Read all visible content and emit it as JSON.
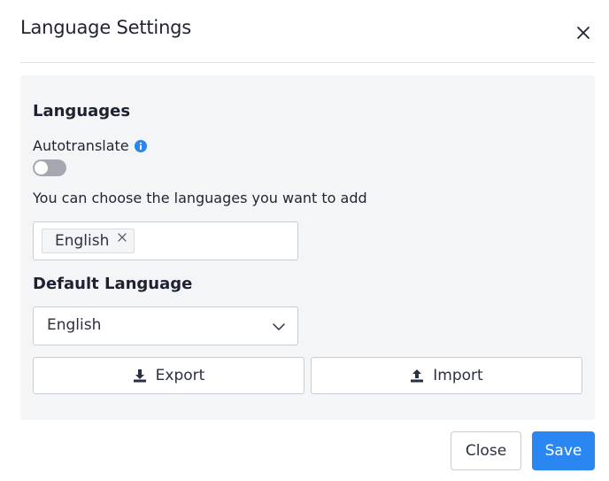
{
  "dialog": {
    "title": "Language Settings",
    "close_icon": "close-icon"
  },
  "languages": {
    "heading": "Languages",
    "autotranslate_label": "Autotranslate",
    "autotranslate_enabled": false,
    "info_icon": "info-icon",
    "helper_text": "You can choose the languages you want to add",
    "selected": [
      "English"
    ]
  },
  "default_language": {
    "heading": "Default Language",
    "value": "English"
  },
  "actions": {
    "export_label": "Export",
    "import_label": "Import"
  },
  "footer": {
    "close_label": "Close",
    "save_label": "Save"
  },
  "colors": {
    "accent": "#2a86f0",
    "panel_bg": "#f4f5f7",
    "info_icon": "#2a86f0",
    "toggle_off": "#a5a8b0"
  }
}
